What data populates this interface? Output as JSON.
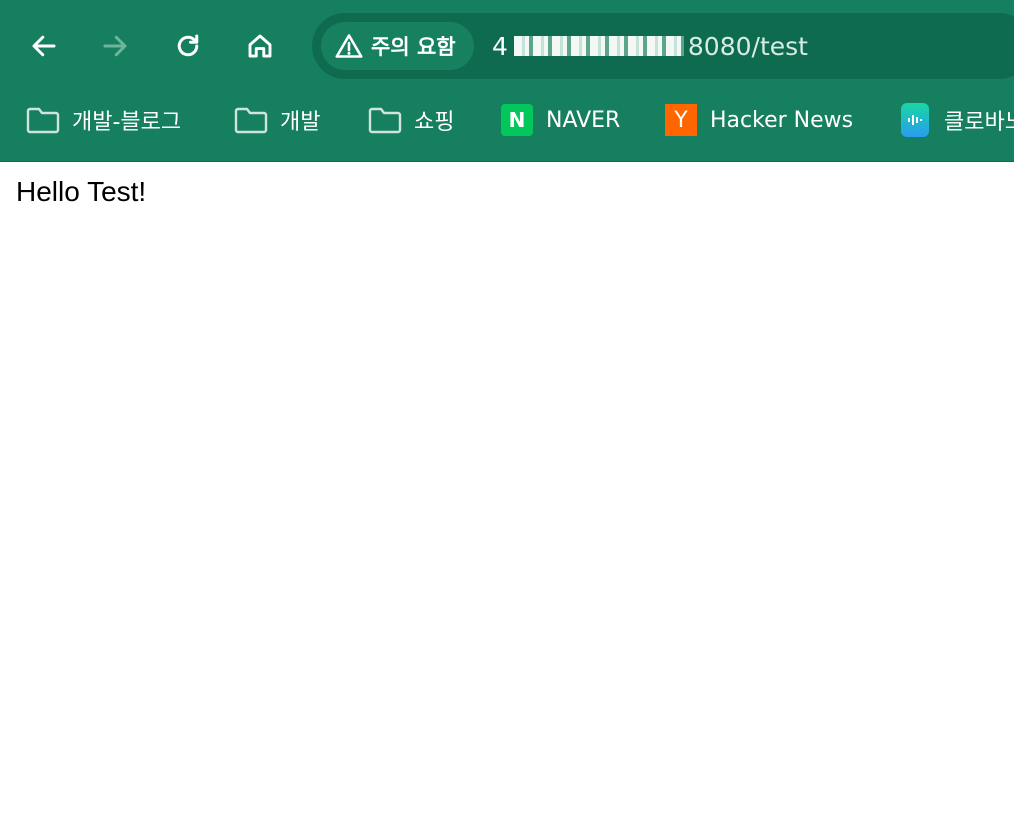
{
  "toolbar": {
    "back_icon": "arrow-left-icon",
    "forward_icon": "arrow-right-icon",
    "reload_icon": "reload-icon",
    "home_icon": "home-icon"
  },
  "omnibox": {
    "security_label": "주의 요함",
    "security_icon": "warning-triangle-icon",
    "url_host_prefix": "4",
    "url_host_suffix": "8080",
    "url_path": "/test"
  },
  "bookmarks": [
    {
      "label": "개발-블로그",
      "icon": "folder-icon"
    },
    {
      "label": "개발",
      "icon": "folder-icon"
    },
    {
      "label": "쇼핑",
      "icon": "folder-icon"
    },
    {
      "label": "NAVER",
      "icon": "naver-logo-icon",
      "logo_text": "N"
    },
    {
      "label": "Hacker News",
      "icon": "hacker-news-logo-icon",
      "logo_text": "Y"
    },
    {
      "label": "클로바노",
      "icon": "clova-note-logo-icon"
    }
  ],
  "page": {
    "text": "Hello Test!"
  },
  "colors": {
    "chrome_bg": "#167f5f",
    "omnibox_bg": "#0f6b50",
    "naver_green": "#03c75a",
    "hn_orange": "#ff6600"
  }
}
